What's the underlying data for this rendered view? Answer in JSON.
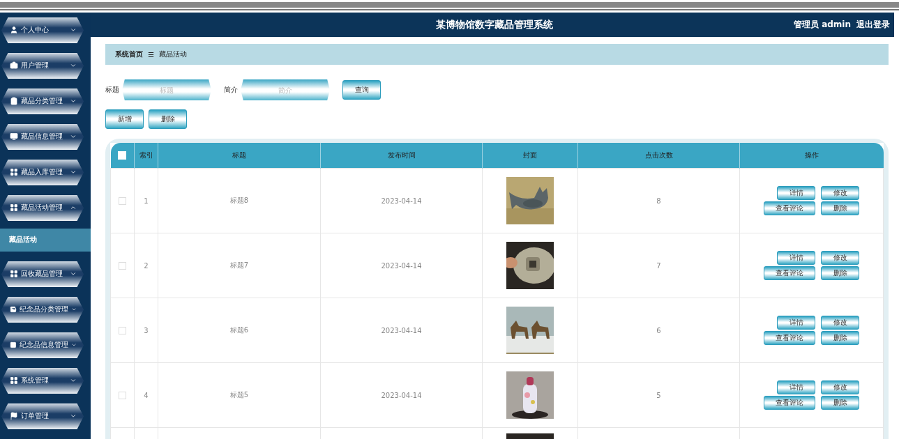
{
  "sidebar": {
    "items": [
      {
        "label": "个人中心",
        "expanded": false
      },
      {
        "label": "用户管理",
        "expanded": false
      },
      {
        "label": "藏品分类管理",
        "expanded": false
      },
      {
        "label": "藏品信息管理",
        "expanded": false
      },
      {
        "label": "藏品入库管理",
        "expanded": false
      },
      {
        "label": "藏品活动管理",
        "expanded": true,
        "children": [
          {
            "label": "藏品活动",
            "selected": true
          }
        ]
      },
      {
        "label": "回收藏品管理",
        "expanded": false
      },
      {
        "label": "纪念品分类管理",
        "expanded": false
      },
      {
        "label": "纪念品信息管理",
        "expanded": false
      },
      {
        "label": "系统管理",
        "expanded": false
      },
      {
        "label": "订单管理",
        "expanded": false
      }
    ]
  },
  "header": {
    "title": "某博物馆数字藏品管理系统",
    "user": "管理员 admin",
    "logout": "退出登录"
  },
  "breadcrumb": {
    "home": "系统首页",
    "separator": "☰",
    "current": "藏品活动"
  },
  "search": {
    "fields": [
      {
        "label": "标题",
        "placeholder": "标题"
      },
      {
        "label": "简介",
        "placeholder": "简介"
      }
    ],
    "button": "查询"
  },
  "toolbar": [
    "新增",
    "删除"
  ],
  "table": {
    "all_checked": false,
    "columns": [
      "索引",
      "标题",
      "发布时间",
      "封面",
      "点击次数",
      "操作"
    ],
    "rows": [
      {
        "checked": false,
        "index": "1",
        "title": "标题8",
        "date": "2023-04-14",
        "clicks": "8",
        "actions": [
          "详情",
          "修改",
          "查看评论",
          "删除"
        ]
      },
      {
        "checked": false,
        "index": "2",
        "title": "标题7",
        "date": "2023-04-14",
        "clicks": "7",
        "actions": [
          "详情",
          "修改",
          "查看评论",
          "删除"
        ]
      },
      {
        "checked": false,
        "index": "3",
        "title": "标题6",
        "date": "2023-04-14",
        "clicks": "6",
        "actions": [
          "详情",
          "修改",
          "查看评论",
          "删除"
        ]
      },
      {
        "checked": false,
        "index": "4",
        "title": "标题5",
        "date": "2023-04-14",
        "clicks": "5",
        "actions": [
          "详情",
          "修改",
          "查看评论",
          "删除"
        ]
      }
    ]
  }
}
